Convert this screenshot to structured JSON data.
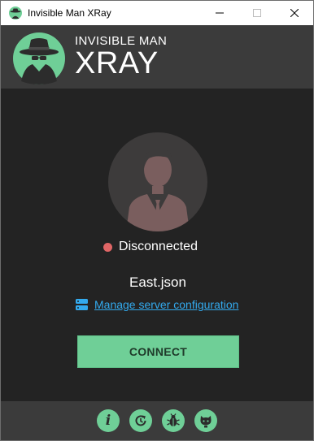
{
  "window": {
    "title": "Invisible Man XRay",
    "controls": [
      "minimize-icon",
      "maximize-icon",
      "close-icon"
    ]
  },
  "header": {
    "subtitle": "INVISIBLE MAN",
    "title": "XRAY",
    "logo_icon": "invisible-man-icon"
  },
  "main": {
    "avatar_icon": "user-silhouette-icon",
    "status": {
      "label": "Disconnected",
      "color": "#e06666"
    },
    "config_name": "East.json",
    "manage_link": {
      "icon": "server-icon",
      "label": "Manage server configuration"
    },
    "connect_button": "CONNECT"
  },
  "footer": {
    "buttons": [
      {
        "icon": "info-icon",
        "glyph": "i"
      },
      {
        "icon": "update-icon"
      },
      {
        "icon": "bug-report-icon"
      },
      {
        "icon": "github-icon"
      }
    ]
  },
  "colors": {
    "accent": "#6fcf97",
    "link": "#33aaee",
    "background": "#232323",
    "panel": "#3b3b3b"
  }
}
